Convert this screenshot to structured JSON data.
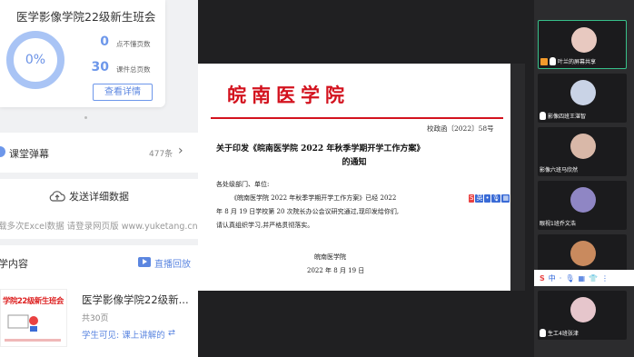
{
  "left": {
    "class_card": {
      "title": "医学影像学院22级新生班会",
      "progress": "0%",
      "progress_value": 0,
      "stat_unclear_value": "0",
      "stat_unclear_label": "点不懂页数",
      "stat_pages_value": "30",
      "stat_pages_label": "课件总页数",
      "detail_button": "查看详情"
    },
    "danmaku": {
      "title": "课堂弹幕",
      "count": "477条"
    },
    "send_data": {
      "title": "发送详细数据",
      "subtitle": "载多次Excel数据 请登录网页版 www.yuketang.cn"
    },
    "content": {
      "title": "学内容",
      "replay": "直播回放",
      "thumb_title": "学院22级新生班会",
      "doc_title": "医学影像学院22级新...",
      "pages": "共30页",
      "visibility": "学生可见: 课上讲解的",
      "link_icon": "link-icon"
    }
  },
  "document": {
    "header": "皖南医学院",
    "ref": "校政函〔2022〕58号",
    "title_line1": "关于印发《皖南医学院 2022 年秋季学期开学工作方案》",
    "title_line2": "的通知",
    "salutation": "各处级部门、单位:",
    "body_line1": "《皖南医学院 2022 年秋季学期开学工作方案》已经 2022",
    "body_line2": "年 8 月 19 日学校第 20 次院长办公会议研究通过,现印发给你们,",
    "body_line3": "请认真组织学习,并严格贯彻落实。",
    "signature": "皖南医学院",
    "date": "2022 年 8 月 19 日",
    "ime_toolbar": [
      "S",
      "英",
      "•",
      "🎙",
      "▦",
      "👕"
    ]
  },
  "participants": [
    {
      "name": "叶兰的屏幕共享",
      "avatar_color": "#e8c9c0",
      "active": true,
      "muted": false
    },
    {
      "name": "影像四班王湛智",
      "avatar_color": "#c9d3e6",
      "active": false,
      "muted": false
    },
    {
      "name": "影像六班马欣然",
      "avatar_color": "#d9b8a8",
      "active": false,
      "muted": false
    },
    {
      "name": "眼视1班乔文浩",
      "avatar_color": "#8f86c4",
      "active": false,
      "muted": false
    },
    {
      "name": "",
      "avatar_color": "#c98a5e",
      "active": false,
      "muted": false
    },
    {
      "name": "生工4班张津",
      "avatar_color": "#e6c6cc",
      "active": false,
      "muted": false
    }
  ],
  "ime_bar": [
    "S",
    "中",
    "·",
    "🎙",
    "▦",
    "👕",
    "⋮"
  ],
  "colors": {
    "accent": "#5b86e0",
    "doc_red": "#d3121e",
    "active_border": "#37c08a"
  }
}
